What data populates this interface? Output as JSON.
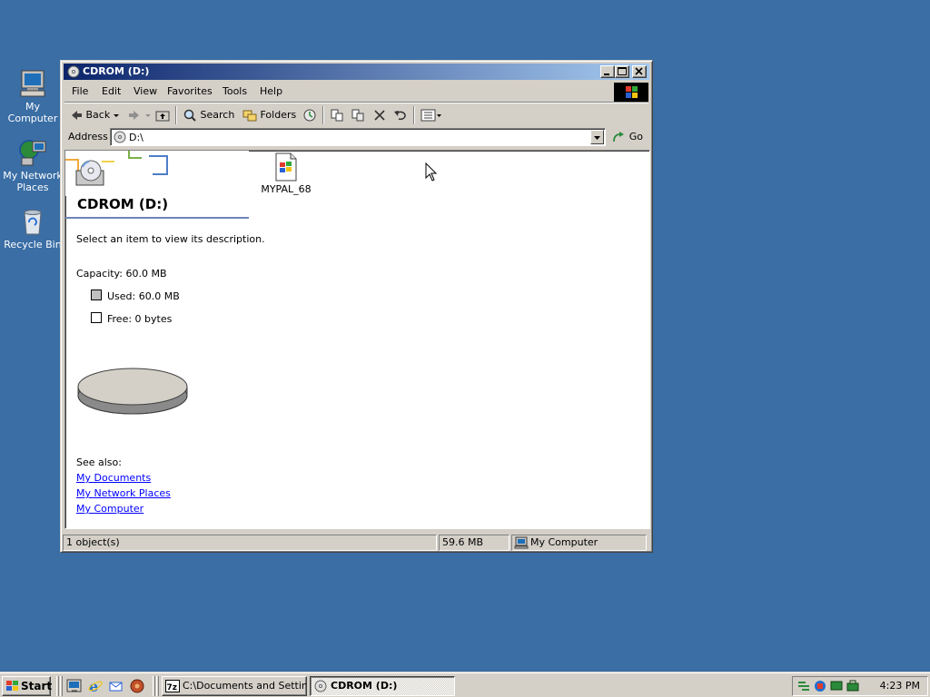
{
  "desktop": {
    "icons": [
      {
        "label": "My Computer",
        "icon": "computer-icon"
      },
      {
        "label": "My Network Places",
        "icon": "network-places-icon"
      },
      {
        "label": "Recycle Bin",
        "icon": "recycle-bin-icon"
      }
    ],
    "background_color": "#3a6ea5"
  },
  "window": {
    "title": "CDROM (D:)",
    "menu": [
      "File",
      "Edit",
      "View",
      "Favorites",
      "Tools",
      "Help"
    ],
    "toolbar": {
      "back": "Back",
      "search": "Search",
      "folders": "Folders"
    },
    "address": {
      "label": "Address",
      "value": "D:\\",
      "go": "Go"
    },
    "webview": {
      "title": "CDROM (D:)",
      "hint": "Select an item to view its description.",
      "capacity": "Capacity: 60.0 MB",
      "used": "Used: 60.0 MB",
      "free": "Free: 0 bytes",
      "used_fraction": 1.0,
      "see_also": "See also:",
      "links": [
        "My Documents",
        "My Network Places",
        "My Computer"
      ]
    },
    "files": [
      {
        "name": "MYPAL_68",
        "icon": "windows-file-icon"
      }
    ],
    "status": {
      "objects": "1 object(s)",
      "size": "59.6 MB",
      "zone": "My Computer"
    }
  },
  "taskbar": {
    "start": "Start",
    "tasks": [
      {
        "label": "C:\\Documents and Settin...",
        "active": false,
        "icon": "7zip-icon"
      },
      {
        "label": "CDROM (D:)",
        "active": true,
        "icon": "cdrom-icon"
      }
    ],
    "clock": "4:23 PM"
  },
  "colors": {
    "title_bar_start": "#0a246a",
    "title_bar_end": "#a6caf0",
    "face": "#d4d0c8",
    "link": "#0000ff"
  }
}
